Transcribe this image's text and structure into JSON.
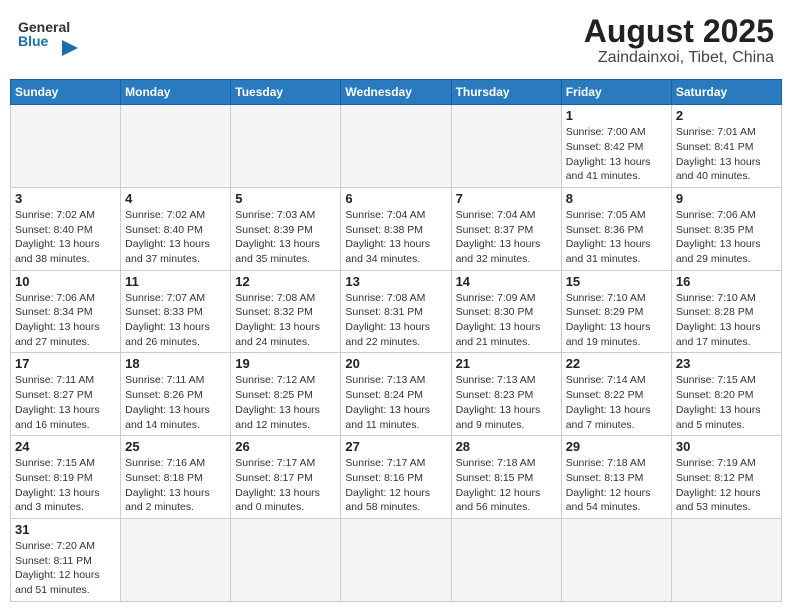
{
  "header": {
    "logo_general": "General",
    "logo_blue": "Blue",
    "title": "August 2025",
    "subtitle": "Zaindainxoi, Tibet, China"
  },
  "weekdays": [
    "Sunday",
    "Monday",
    "Tuesday",
    "Wednesday",
    "Thursday",
    "Friday",
    "Saturday"
  ],
  "weeks": [
    [
      {
        "day": "",
        "info": ""
      },
      {
        "day": "",
        "info": ""
      },
      {
        "day": "",
        "info": ""
      },
      {
        "day": "",
        "info": ""
      },
      {
        "day": "",
        "info": ""
      },
      {
        "day": "1",
        "info": "Sunrise: 7:00 AM\nSunset: 8:42 PM\nDaylight: 13 hours\nand 41 minutes."
      },
      {
        "day": "2",
        "info": "Sunrise: 7:01 AM\nSunset: 8:41 PM\nDaylight: 13 hours\nand 40 minutes."
      }
    ],
    [
      {
        "day": "3",
        "info": "Sunrise: 7:02 AM\nSunset: 8:40 PM\nDaylight: 13 hours\nand 38 minutes."
      },
      {
        "day": "4",
        "info": "Sunrise: 7:02 AM\nSunset: 8:40 PM\nDaylight: 13 hours\nand 37 minutes."
      },
      {
        "day": "5",
        "info": "Sunrise: 7:03 AM\nSunset: 8:39 PM\nDaylight: 13 hours\nand 35 minutes."
      },
      {
        "day": "6",
        "info": "Sunrise: 7:04 AM\nSunset: 8:38 PM\nDaylight: 13 hours\nand 34 minutes."
      },
      {
        "day": "7",
        "info": "Sunrise: 7:04 AM\nSunset: 8:37 PM\nDaylight: 13 hours\nand 32 minutes."
      },
      {
        "day": "8",
        "info": "Sunrise: 7:05 AM\nSunset: 8:36 PM\nDaylight: 13 hours\nand 31 minutes."
      },
      {
        "day": "9",
        "info": "Sunrise: 7:06 AM\nSunset: 8:35 PM\nDaylight: 13 hours\nand 29 minutes."
      }
    ],
    [
      {
        "day": "10",
        "info": "Sunrise: 7:06 AM\nSunset: 8:34 PM\nDaylight: 13 hours\nand 27 minutes."
      },
      {
        "day": "11",
        "info": "Sunrise: 7:07 AM\nSunset: 8:33 PM\nDaylight: 13 hours\nand 26 minutes."
      },
      {
        "day": "12",
        "info": "Sunrise: 7:08 AM\nSunset: 8:32 PM\nDaylight: 13 hours\nand 24 minutes."
      },
      {
        "day": "13",
        "info": "Sunrise: 7:08 AM\nSunset: 8:31 PM\nDaylight: 13 hours\nand 22 minutes."
      },
      {
        "day": "14",
        "info": "Sunrise: 7:09 AM\nSunset: 8:30 PM\nDaylight: 13 hours\nand 21 minutes."
      },
      {
        "day": "15",
        "info": "Sunrise: 7:10 AM\nSunset: 8:29 PM\nDaylight: 13 hours\nand 19 minutes."
      },
      {
        "day": "16",
        "info": "Sunrise: 7:10 AM\nSunset: 8:28 PM\nDaylight: 13 hours\nand 17 minutes."
      }
    ],
    [
      {
        "day": "17",
        "info": "Sunrise: 7:11 AM\nSunset: 8:27 PM\nDaylight: 13 hours\nand 16 minutes."
      },
      {
        "day": "18",
        "info": "Sunrise: 7:11 AM\nSunset: 8:26 PM\nDaylight: 13 hours\nand 14 minutes."
      },
      {
        "day": "19",
        "info": "Sunrise: 7:12 AM\nSunset: 8:25 PM\nDaylight: 13 hours\nand 12 minutes."
      },
      {
        "day": "20",
        "info": "Sunrise: 7:13 AM\nSunset: 8:24 PM\nDaylight: 13 hours\nand 11 minutes."
      },
      {
        "day": "21",
        "info": "Sunrise: 7:13 AM\nSunset: 8:23 PM\nDaylight: 13 hours\nand 9 minutes."
      },
      {
        "day": "22",
        "info": "Sunrise: 7:14 AM\nSunset: 8:22 PM\nDaylight: 13 hours\nand 7 minutes."
      },
      {
        "day": "23",
        "info": "Sunrise: 7:15 AM\nSunset: 8:20 PM\nDaylight: 13 hours\nand 5 minutes."
      }
    ],
    [
      {
        "day": "24",
        "info": "Sunrise: 7:15 AM\nSunset: 8:19 PM\nDaylight: 13 hours\nand 3 minutes."
      },
      {
        "day": "25",
        "info": "Sunrise: 7:16 AM\nSunset: 8:18 PM\nDaylight: 13 hours\nand 2 minutes."
      },
      {
        "day": "26",
        "info": "Sunrise: 7:17 AM\nSunset: 8:17 PM\nDaylight: 13 hours\nand 0 minutes."
      },
      {
        "day": "27",
        "info": "Sunrise: 7:17 AM\nSunset: 8:16 PM\nDaylight: 12 hours\nand 58 minutes."
      },
      {
        "day": "28",
        "info": "Sunrise: 7:18 AM\nSunset: 8:15 PM\nDaylight: 12 hours\nand 56 minutes."
      },
      {
        "day": "29",
        "info": "Sunrise: 7:18 AM\nSunset: 8:13 PM\nDaylight: 12 hours\nand 54 minutes."
      },
      {
        "day": "30",
        "info": "Sunrise: 7:19 AM\nSunset: 8:12 PM\nDaylight: 12 hours\nand 53 minutes."
      }
    ],
    [
      {
        "day": "31",
        "info": "Sunrise: 7:20 AM\nSunset: 8:11 PM\nDaylight: 12 hours\nand 51 minutes."
      },
      {
        "day": "",
        "info": ""
      },
      {
        "day": "",
        "info": ""
      },
      {
        "day": "",
        "info": ""
      },
      {
        "day": "",
        "info": ""
      },
      {
        "day": "",
        "info": ""
      },
      {
        "day": "",
        "info": ""
      }
    ]
  ]
}
